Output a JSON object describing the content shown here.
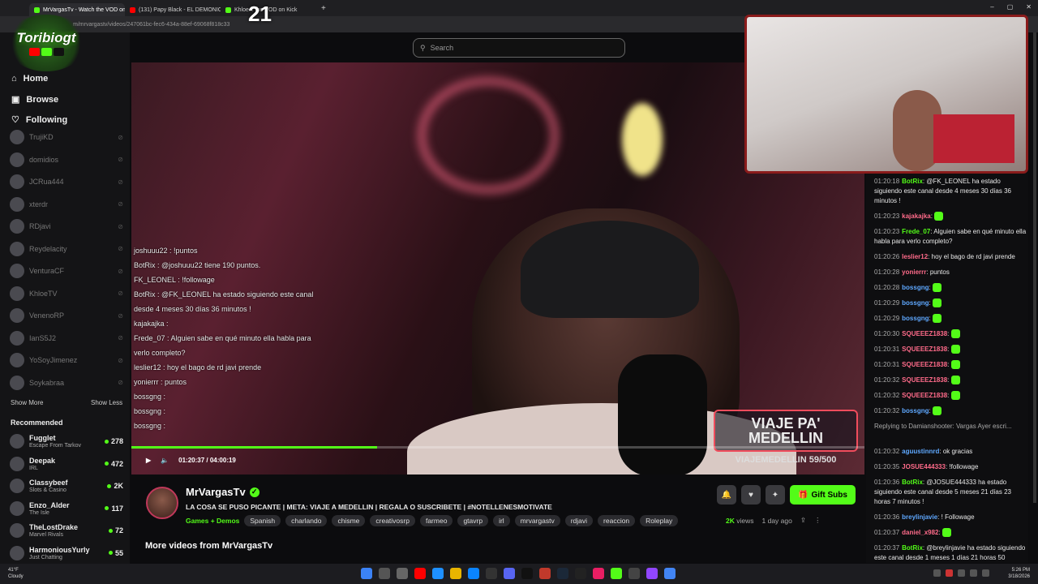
{
  "browser": {
    "tabs": [
      {
        "label": "MrVargasTv - Watch the VOD on K",
        "color": "#53fc18",
        "active": true
      },
      {
        "label": "(131) Papy Black - EL DEMONIO D",
        "color": "#ff0000",
        "active": false
      },
      {
        "label": "Khloe... the VOD on Kick",
        "color": "#53fc18",
        "active": false
      }
    ],
    "url": "m/mrvargastv/videos/247061bc-fec6-434a-88ef-69068f818c33"
  },
  "overlay": {
    "logo_text": "Toribiogt",
    "counter": "21"
  },
  "search": {
    "placeholder": "Search"
  },
  "sidebar": {
    "nav": [
      {
        "label": "Home",
        "icon": "home-icon"
      },
      {
        "label": "Browse",
        "icon": "browse-icon"
      },
      {
        "label": "Following",
        "icon": "heart-icon"
      }
    ],
    "following": [
      "TrujiKD",
      "domidios",
      "JCRua444",
      "xterdr",
      "RDjavi",
      "Reydelacity",
      "VenturaCF",
      "KhloeTV",
      "VenenoRP",
      "IanS5J2",
      "YoSoyJimenez",
      "Soykabraa"
    ],
    "show_more": "Show More",
    "show_less": "Show Less",
    "recommended_title": "Recommended",
    "recommended": [
      {
        "name": "Fugglet",
        "game": "Escape From Tarkov",
        "viewers": "278"
      },
      {
        "name": "Deepak",
        "game": "IRL",
        "viewers": "472"
      },
      {
        "name": "Classybeef",
        "game": "Slots & Casino",
        "viewers": "2K"
      },
      {
        "name": "Enzo_Alder",
        "game": "The Isle",
        "viewers": "117"
      },
      {
        "name": "TheLostDrake",
        "game": "Marvel Rivals",
        "viewers": "72"
      },
      {
        "name": "HarmoniousYurly",
        "game": "Just Chatting",
        "viewers": "55"
      }
    ]
  },
  "video": {
    "banner": "VIAJE PA' MEDELLIN",
    "goal": "VIAJEMEDELLIN 59/500",
    "current_time": "01:20:37",
    "separator": "/",
    "duration": "04:00:19",
    "progress": 0.335,
    "overlay_chat": [
      "joshuuu22 : !puntos",
      "BotRix : @joshuuu22 tiene 190 puntos.",
      "FK_LEONEL : !followage",
      "BotRix : @FK_LEONEL ha estado siguiendo este canal desde 4 meses 30 días 36 minutos !",
      "kajakajka :",
      "Frede_07 : Alguien sabe en qué minuto ella habla para verlo completo?",
      "leslier12 : hoy el bago de rd javi prende",
      "yonierrr : puntos",
      "bossgng :",
      "bossgng :",
      "bossgng :"
    ]
  },
  "chat": {
    "messages": [
      {
        "time": "01:20:18",
        "user": "BotRix",
        "color": "#53fc18",
        "text": "@FK_LEONEL ha estado siguiendo este canal desde 4 meses 30 días 36 minutos !"
      },
      {
        "time": "01:20:23",
        "user": "kajakajka",
        "color": "#ff6b8a",
        "text": ""
      },
      {
        "time": "01:20:23",
        "user": "Frede_07",
        "color": "#53fc18",
        "text": "Alguien sabe en qué minuto ella habla para verlo completo?"
      },
      {
        "time": "01:20:26",
        "user": "leslier12",
        "color": "#ff6b8a",
        "text": "hoy el bago de rd javi prende"
      },
      {
        "time": "01:20:28",
        "user": "yonierrr",
        "color": "#ff6b8a",
        "text": "puntos"
      },
      {
        "time": "01:20:28",
        "user": "bossgng",
        "color": "#5fa8ff",
        "text": ""
      },
      {
        "time": "01:20:29",
        "user": "bossgng",
        "color": "#5fa8ff",
        "text": ""
      },
      {
        "time": "01:20:29",
        "user": "bossgng",
        "color": "#5fa8ff",
        "text": ""
      },
      {
        "time": "01:20:30",
        "user": "SQUEEEZ1838",
        "color": "#ff6b8a",
        "text": ""
      },
      {
        "time": "01:20:31",
        "user": "SQUEEEZ1838",
        "color": "#ff6b8a",
        "text": ""
      },
      {
        "time": "01:20:31",
        "user": "SQUEEEZ1838",
        "color": "#ff6b8a",
        "text": ""
      },
      {
        "time": "01:20:32",
        "user": "SQUEEEZ1838",
        "color": "#ff6b8a",
        "text": ""
      },
      {
        "time": "01:20:32",
        "user": "SQUEEEZ1838",
        "color": "#ff6b8a",
        "text": ""
      },
      {
        "time": "01:20:32",
        "user": "bossgng",
        "color": "#5fa8ff",
        "text": ""
      },
      {
        "time": "",
        "user": "",
        "color": "#aaaaaa",
        "text": "Replying to Damianshooter: Vargas Ayer escri..."
      },
      {
        "time": "01:20:32",
        "user": "aguustinnrd",
        "color": "#5fa8ff",
        "text": "ok gracias"
      },
      {
        "time": "01:20:35",
        "user": "JOSUE444333",
        "color": "#ff6b8a",
        "text": "!followage"
      },
      {
        "time": "01:20:36",
        "user": "BotRix",
        "color": "#53fc18",
        "text": "@JOSUE444333 ha estado siguiendo este canal desde 5 meses 21 días 23 horas 7 minutos !"
      },
      {
        "time": "01:20:36",
        "user": "breylinjavie",
        "color": "#5fa8ff",
        "text": "! Followage"
      },
      {
        "time": "01:20:37",
        "user": "daniel_x982",
        "color": "#ff6b8a",
        "text": ""
      },
      {
        "time": "01:20:37",
        "user": "BotRix",
        "color": "#53fc18",
        "text": "@breylinjavie ha estado siguiendo este canal desde 1 meses 1 días 21 horas 50 minutos !"
      }
    ]
  },
  "info": {
    "channel": "MrVargasTv",
    "title": "LA COSA SE PUSO PICANTE | META: VIAJE A MEDELLIN | REGALA O SUSCRIBETE | #NOTELLENESMOTIVATE",
    "category": "Games + Demos",
    "tags": [
      "Spanish",
      "charlando",
      "chisme",
      "creativosrp",
      "farmeo",
      "gtavrp",
      "irl",
      "mrvargastv",
      "rdjavi",
      "reaccion",
      "Roleplay"
    ],
    "views_count": "2K",
    "views_label": "views",
    "age": "1 day ago",
    "gift_label": "Gift Subs",
    "more_videos": "More videos from MrVargasTv"
  },
  "taskbar": {
    "weather_temp": "41°F",
    "weather_desc": "Cloudy",
    "time": "5:26 PM",
    "date": "3/18/2026"
  }
}
